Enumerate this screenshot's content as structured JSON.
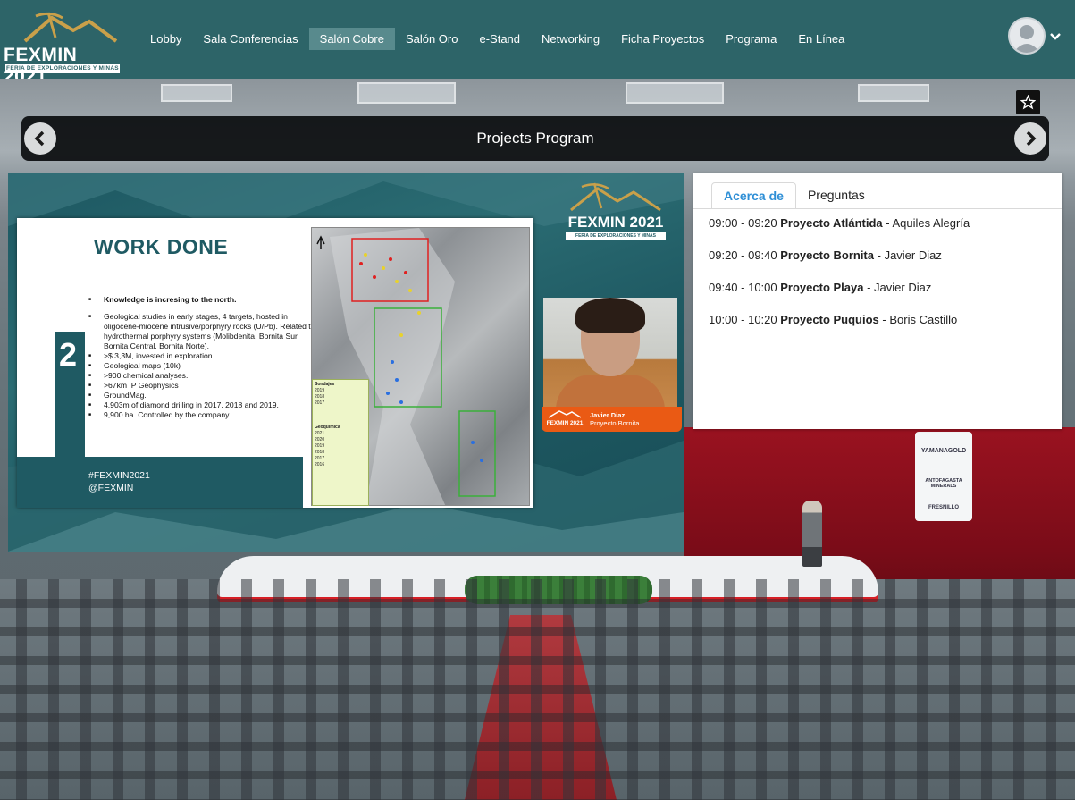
{
  "brand": {
    "title": "FEXMIN 2021",
    "subtitle": "FERIA DE EXPLORACIONES Y MINAS",
    "accent": "#2d6468"
  },
  "nav": {
    "items": [
      {
        "label": "Lobby",
        "active": false
      },
      {
        "label": "Sala Conferencias",
        "active": false
      },
      {
        "label": "Salón Cobre",
        "active": true
      },
      {
        "label": "Salón Oro",
        "active": false
      },
      {
        "label": "e-Stand",
        "active": false
      },
      {
        "label": "Networking",
        "active": false
      },
      {
        "label": "Ficha Proyectos",
        "active": false
      },
      {
        "label": "Programa",
        "active": false
      },
      {
        "label": "En Línea",
        "active": false
      }
    ],
    "user_icon": "user-avatar-icon",
    "menu_icon": "chevron-down-icon"
  },
  "header": {
    "title": "Projects Program",
    "prev_icon": "chevron-left-icon",
    "next_icon": "chevron-right-icon",
    "favorite_icon": "star-outline-icon"
  },
  "slide": {
    "number": "2",
    "title": "WORK DONE",
    "bullets": [
      "Knowledge is incresing to the north.",
      "Geological studies in early stages, 4 targets, hosted in oligocene-miocene  intrusive/porphyry rocks (U/Pb). Related to hydrothermal porphyry systems (Molibdenita, Bornita Sur, Bornita Central, Bornita Norte).",
      ">$ 3,3M, invested in exploration.",
      "Geological maps (10k)",
      ">900 chemical analyses.",
      ">67km IP Geophysics",
      "GroundMag.",
      "4,903m of diamond drilling in 2017, 2018 and 2019.",
      "9,900 ha. Controlled by the company."
    ],
    "hashtag": "#FEXMIN2021",
    "handle": "@FEXMIN",
    "map_legend": {
      "title_drill": "Sondajes",
      "items_drill": [
        "2019",
        "2018",
        "2017"
      ],
      "title_geochem": "Geoquimica",
      "items_geochem": [
        "2021",
        "2020",
        "2019",
        "2018",
        "2017",
        "2016"
      ]
    }
  },
  "speaker": {
    "name": "Javier Diaz",
    "role": "Proyecto Bornita",
    "label_logo": "FEXMIN 2021"
  },
  "panel": {
    "tabs": [
      {
        "label": "Acerca de",
        "active": true
      },
      {
        "label": "Preguntas",
        "active": false
      }
    ],
    "schedule": [
      {
        "time": "09:00 - 09:20",
        "project": "Proyecto Atlántida",
        "speaker": "Aquiles Alegría"
      },
      {
        "time": "09:20 - 09:40",
        "project": "Proyecto Bornita",
        "speaker": "Javier Diaz"
      },
      {
        "time": "09:40 - 10:00",
        "project": "Proyecto Playa",
        "speaker": "Javier Diaz"
      },
      {
        "time": "10:00 - 10:20",
        "project": "Proyecto Puquios",
        "speaker": "Boris Castillo"
      }
    ],
    "active_color": "#2f8fd6"
  },
  "sponsors": [
    "YAMANAGOLD",
    "ANTOFAGASTA MINERALS",
    "FRESNILLO"
  ]
}
